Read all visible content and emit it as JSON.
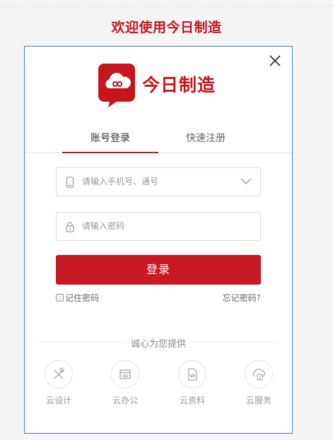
{
  "header": {
    "welcome": "欢迎使用今日制造"
  },
  "brand": {
    "name": "今日制造",
    "color": "#c4161c"
  },
  "tabs": [
    {
      "label": "账号登录",
      "active": true
    },
    {
      "label": "快速注册",
      "active": false
    }
  ],
  "form": {
    "phone_placeholder": "请输入手机号、通号",
    "password_placeholder": "请输入密码",
    "login_label": "登录",
    "remember_label": "记住密码",
    "forgot_label": "忘记密码?"
  },
  "services": {
    "heading": "诚心为您提供",
    "items": [
      {
        "label": "云设计",
        "icon": "design-icon"
      },
      {
        "label": "云办公",
        "icon": "office-icon"
      },
      {
        "label": "云资料",
        "icon": "document-icon"
      },
      {
        "label": "云服务",
        "icon": "service-icon"
      }
    ]
  },
  "colors": {
    "accent": "#c81a22",
    "dialog_border": "#3b83bf"
  }
}
